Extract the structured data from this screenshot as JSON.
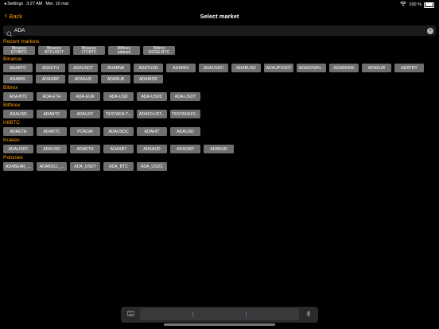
{
  "status": {
    "back_app": "◂ Settings",
    "time": "3:27 AM",
    "date": "Mer. 10 mai",
    "battery_text": "100 %"
  },
  "nav": {
    "back_label": "Back",
    "title": "Select market"
  },
  "search": {
    "value": "ADA",
    "placeholder": ""
  },
  "sections": {
    "recent": {
      "title": "Recent markets",
      "items": [
        [
          "Binance",
          "ETHBTC"
        ],
        [
          "Binance",
          "BTCUSDT"
        ],
        [
          "Binance",
          "LTCBTC"
        ],
        [
          "Bitfinex",
          "adausd"
        ],
        [
          "Bittrex",
          "DOGE-BTC"
        ]
      ]
    },
    "binance": {
      "title": "Binance",
      "row1": [
        "ADABTC",
        "ADAETH",
        "ADAUSDT",
        "ADABNB",
        "ADATUSD",
        "ADAPAX",
        "ADAUSDC",
        "ADABUSD",
        "ADAUPUSDT",
        "ADADOWN...",
        "ADABKRW",
        "ADAEUR",
        "ADATRY"
      ],
      "row2": [
        "ADABRL",
        "ADAGBP",
        "ADAAUD",
        "ADARUB",
        "ADABIDR"
      ]
    },
    "bittrex": {
      "title": "Bittrex",
      "items": [
        "ADA-BTC",
        "ADA-ETH",
        "ADA-EUR",
        "ADA-USD",
        "ADA-USDC",
        "ADA-USDT"
      ]
    },
    "bitfinex": {
      "title": "Bitfinex",
      "items": [
        "ADAUSD",
        "ADABTC",
        "ADAUST",
        "TESTADA:T...",
        "ADAF0:UST...",
        "TESTADAF0..."
      ]
    },
    "hitbtc": {
      "title": "HitBTC",
      "items": [
        "ADAETH",
        "ADABTC",
        "POADAI",
        "ADAUSDC",
        "ADAHIT",
        "ADAUSD"
      ]
    },
    "kraken": {
      "title": "Kraken",
      "items": [
        "ADAUSDT",
        "ADAUSD",
        "ADAETH",
        "ADAXBT",
        "ADAAUD",
        "ADAGBP",
        "ADAEUR"
      ]
    },
    "poloniex": {
      "title": "Poloniex",
      "items": [
        "ADABEAR_...",
        "ADABULL_...",
        "ADA_USDT",
        "ADA_BTC",
        "ADA_USDC"
      ]
    }
  },
  "colors": {
    "accent": "#ff9f0a",
    "chip": "#6f6f72",
    "background": "#000000"
  }
}
